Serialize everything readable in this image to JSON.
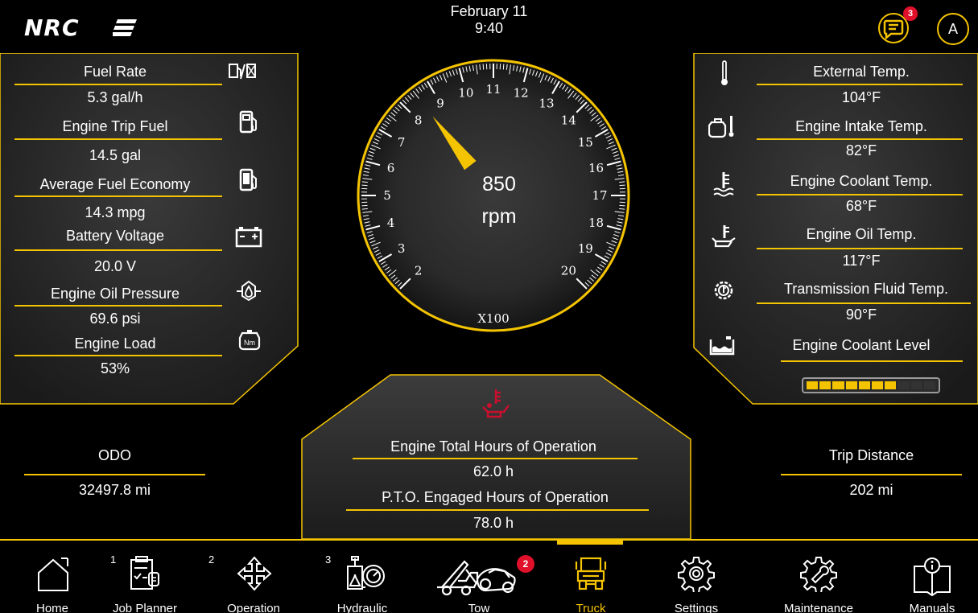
{
  "header": {
    "brand": "NRC",
    "date": "February 11",
    "time": "9:40",
    "messages_badge": "3",
    "avatar_initial": "A"
  },
  "left_panel": [
    {
      "label": "Fuel Rate",
      "value": "5.3 gal/h",
      "icon": "fuel-rate-icon"
    },
    {
      "label": "Engine Trip Fuel",
      "value": "14.5 gal",
      "icon": "fuel-pump-icon"
    },
    {
      "label": "Average Fuel Economy",
      "value": "14.3 mpg",
      "icon": "fuel-economy-icon"
    },
    {
      "label": "Battery Voltage",
      "value": "20.0 V",
      "icon": "battery-icon"
    },
    {
      "label": "Engine Oil Pressure",
      "value": "69.6 psi",
      "icon": "oil-pressure-icon"
    },
    {
      "label": "Engine Load",
      "value": "53%",
      "icon": "engine-load-icon"
    }
  ],
  "right_panel": [
    {
      "label": "External Temp.",
      "value": "104°F",
      "icon": "thermometer-icon"
    },
    {
      "label": "Engine Intake Temp.",
      "value": "82°F",
      "icon": "intake-temp-icon"
    },
    {
      "label": "Engine Coolant Temp.",
      "value": "68°F",
      "icon": "coolant-temp-icon"
    },
    {
      "label": "Engine Oil Temp.",
      "value": "117°F",
      "icon": "oil-temp-icon"
    },
    {
      "label": "Transmission Fluid Temp.",
      "value": "90°F",
      "icon": "transmission-temp-icon"
    },
    {
      "label": "Engine Coolant Level",
      "value": "",
      "icon": "coolant-level-icon"
    }
  ],
  "coolant_level": {
    "filled_segments": 7,
    "total_segments": 10,
    "accent": "#f5c400"
  },
  "gauge": {
    "value": "850",
    "unit": "rpm",
    "multiplier": "X100",
    "min": 2,
    "max": 20,
    "tick_labels": [
      "2",
      "3",
      "4",
      "5",
      "6",
      "7",
      "8",
      "9",
      "10",
      "11",
      "12",
      "13",
      "14",
      "15",
      "16",
      "17",
      "18",
      "19",
      "20"
    ],
    "needle_value": 8.5
  },
  "odo": {
    "label": "ODO",
    "value": "32497.8 mi"
  },
  "trip": {
    "label": "Trip Distance",
    "value": "202 mi"
  },
  "center_panel": {
    "engine_hours_label": "Engine Total Hours of Operation",
    "engine_hours_value": "62.0 h",
    "pto_hours_label": "P.T.O. Engaged Hours of Operation",
    "pto_hours_value": "78.0 h",
    "pto_icon": "pto-warning-icon",
    "pto_icon_color": "#c8102e"
  },
  "nav": [
    {
      "label": "Home",
      "icon": "home-icon",
      "number": ""
    },
    {
      "label": "Job Planner",
      "icon": "job-planner-icon",
      "number": "1"
    },
    {
      "label": "Operation",
      "icon": "operation-arrows-icon",
      "number": "2"
    },
    {
      "label": "Hydraulic",
      "icon": "hydraulic-icon",
      "number": "3"
    },
    {
      "label": "Tow",
      "icon": "tow-truck-icon",
      "number": "",
      "badge": "2"
    },
    {
      "label": "Truck",
      "icon": "truck-icon",
      "number": "",
      "active": true
    },
    {
      "label": "Settings",
      "icon": "gear-icon",
      "number": ""
    },
    {
      "label": "Maintenance",
      "icon": "wrench-gear-icon",
      "number": ""
    },
    {
      "label": "Manuals",
      "icon": "manual-book-icon",
      "number": ""
    }
  ],
  "colors": {
    "accent": "#f5c400",
    "badge": "#e0102b",
    "panel": "#262626"
  }
}
